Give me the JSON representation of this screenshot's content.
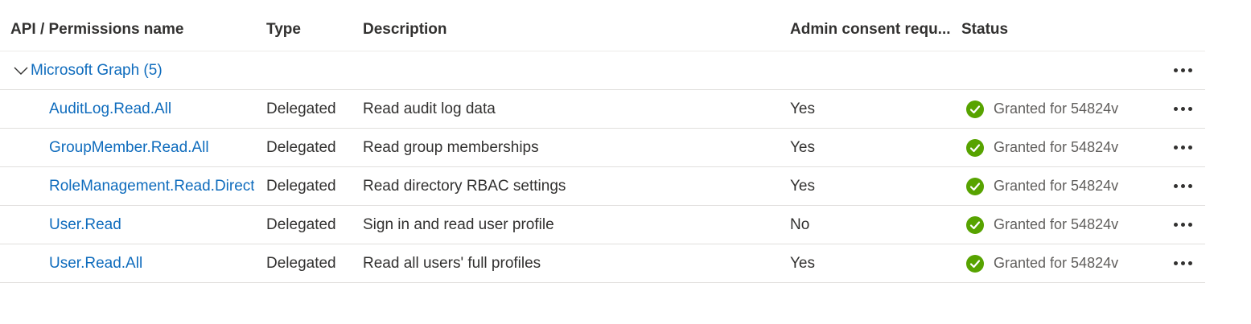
{
  "columns": {
    "name": "API / Permissions name",
    "type": "Type",
    "description": "Description",
    "admin_consent": "Admin consent requ...",
    "status": "Status"
  },
  "group": {
    "label": "Microsoft Graph (5)",
    "expand_icon": "chevron-down-icon"
  },
  "permissions": [
    {
      "name": "AuditLog.Read.All",
      "type": "Delegated",
      "description": "Read audit log data",
      "admin_consent": "Yes",
      "status": "Granted for 54824v"
    },
    {
      "name": "GroupMember.Read.All",
      "type": "Delegated",
      "description": "Read group memberships",
      "admin_consent": "Yes",
      "status": "Granted for 54824v"
    },
    {
      "name": "RoleManagement.Read.Directory",
      "type": "Delegated",
      "description": "Read directory RBAC settings",
      "admin_consent": "Yes",
      "status": "Granted for 54824v"
    },
    {
      "name": "User.Read",
      "type": "Delegated",
      "description": "Sign in and read user profile",
      "admin_consent": "No",
      "status": "Granted for 54824v"
    },
    {
      "name": "User.Read.All",
      "type": "Delegated",
      "description": "Read all users' full profiles",
      "admin_consent": "Yes",
      "status": "Granted for 54824v"
    }
  ],
  "icons": {
    "status": "check-circle-icon",
    "more": "more-options-icon"
  },
  "colors": {
    "link": "#0f6cbd",
    "granted": "#57a300",
    "divider": "#e1dfdd"
  }
}
